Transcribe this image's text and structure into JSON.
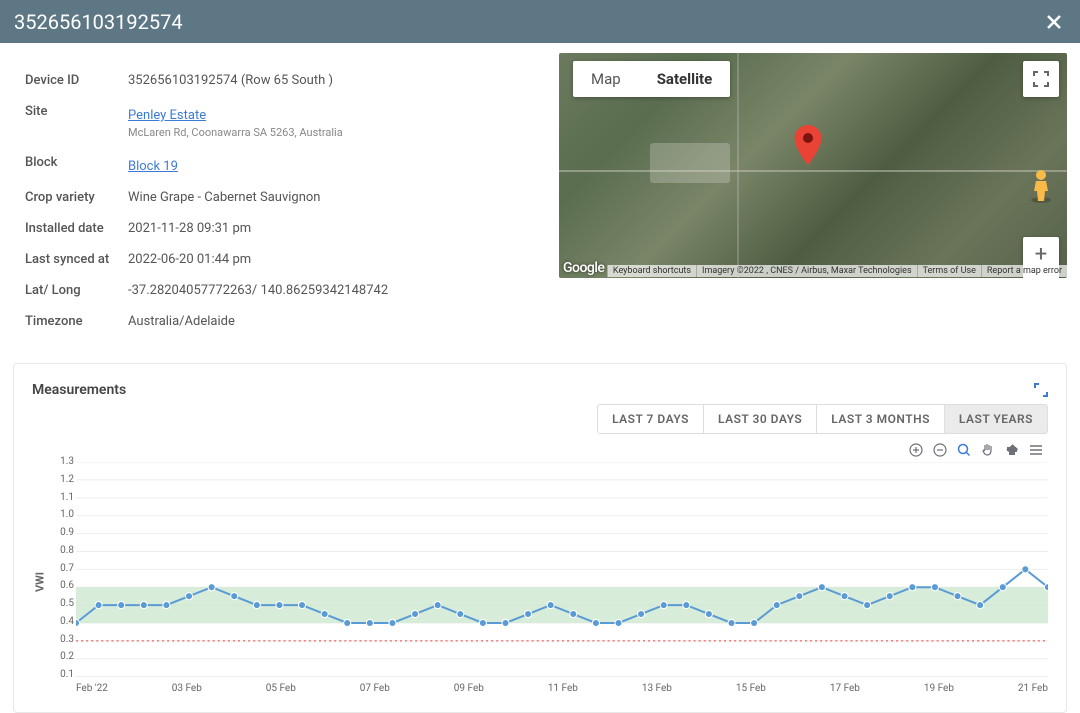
{
  "header": {
    "title": "352656103192574"
  },
  "device": {
    "id_label": "Device ID",
    "id_value": "352656103192574 (Row 65 South )",
    "site_label": "Site",
    "site_link": "Penley Estate",
    "site_addr": "McLaren Rd, Coonawarra SA 5263, Australia",
    "block_label": "Block",
    "block_link": "Block 19",
    "crop_label": "Crop variety",
    "crop_value": "Wine Grape - Cabernet Sauvignon",
    "installed_label": "Installed date",
    "installed_value": "2021-11-28 09:31 pm",
    "sync_label": "Last synced at",
    "sync_value": "2022-06-20 01:44 pm",
    "latlong_label": "Lat/ Long",
    "latlong_value": "-37.28204057772263/ 140.86259342148742",
    "tz_label": "Timezone",
    "tz_value": "Australia/Adelaide"
  },
  "map": {
    "type_map": "Map",
    "type_sat": "Satellite",
    "google": "Google",
    "shortcuts": "Keyboard shortcuts",
    "imagery": "Imagery ©2022 , CNES / Airbus, Maxar Technologies",
    "terms": "Terms of Use",
    "report": "Report a map error"
  },
  "measurements": {
    "title": "Measurements",
    "tabs": {
      "d7": "LAST 7 DAYS",
      "d30": "LAST 30 DAYS",
      "m3": "LAST 3 MONTHS",
      "yrs": "LAST YEARS"
    },
    "ylabel": "VWI"
  },
  "chart_data": {
    "type": "line",
    "title": "",
    "xlabel": "",
    "ylabel": "VWI",
    "ylim": [
      0.1,
      1.3
    ],
    "threshold": 0.3,
    "band": [
      0.4,
      0.6
    ],
    "y_ticks": [
      1.3,
      1.2,
      1.1,
      1.0,
      0.9,
      0.8,
      0.7,
      0.6,
      0.5,
      0.4,
      0.3,
      0.2,
      0.1
    ],
    "x_ticks": [
      "Feb '22",
      "03 Feb",
      "05 Feb",
      "07 Feb",
      "09 Feb",
      "11 Feb",
      "13 Feb",
      "15 Feb",
      "17 Feb",
      "19 Feb",
      "21 Feb"
    ],
    "x": [
      1,
      1.5,
      2,
      2.5,
      3,
      3.5,
      4,
      4.5,
      5,
      5.5,
      6,
      6.5,
      7,
      7.5,
      8,
      8.5,
      9,
      9.5,
      10,
      10.5,
      11,
      11.5,
      12,
      12.5,
      13,
      13.5,
      14,
      14.5,
      15,
      15.5,
      16,
      16.5,
      17,
      17.5,
      18,
      18.5,
      19,
      19.5,
      20,
      20.5,
      21,
      21.5,
      22,
      22.5
    ],
    "values": [
      0.4,
      0.5,
      0.5,
      0.5,
      0.5,
      0.55,
      0.6,
      0.55,
      0.5,
      0.5,
      0.5,
      0.45,
      0.4,
      0.4,
      0.4,
      0.45,
      0.5,
      0.45,
      0.4,
      0.4,
      0.45,
      0.5,
      0.45,
      0.4,
      0.4,
      0.45,
      0.5,
      0.5,
      0.45,
      0.4,
      0.4,
      0.5,
      0.55,
      0.6,
      0.55,
      0.5,
      0.55,
      0.6,
      0.6,
      0.55,
      0.5,
      0.6,
      0.7,
      0.6
    ],
    "series": [
      {
        "name": "VWI",
        "values": [
          0.4,
          0.5,
          0.5,
          0.5,
          0.5,
          0.55,
          0.6,
          0.55,
          0.5,
          0.5,
          0.5,
          0.45,
          0.4,
          0.4,
          0.4,
          0.45,
          0.5,
          0.45,
          0.4,
          0.4,
          0.45,
          0.5,
          0.45,
          0.4,
          0.4,
          0.45,
          0.5,
          0.5,
          0.45,
          0.4,
          0.4,
          0.5,
          0.55,
          0.6,
          0.55,
          0.5,
          0.55,
          0.6,
          0.6,
          0.55,
          0.5,
          0.6,
          0.7,
          0.6
        ]
      }
    ]
  }
}
